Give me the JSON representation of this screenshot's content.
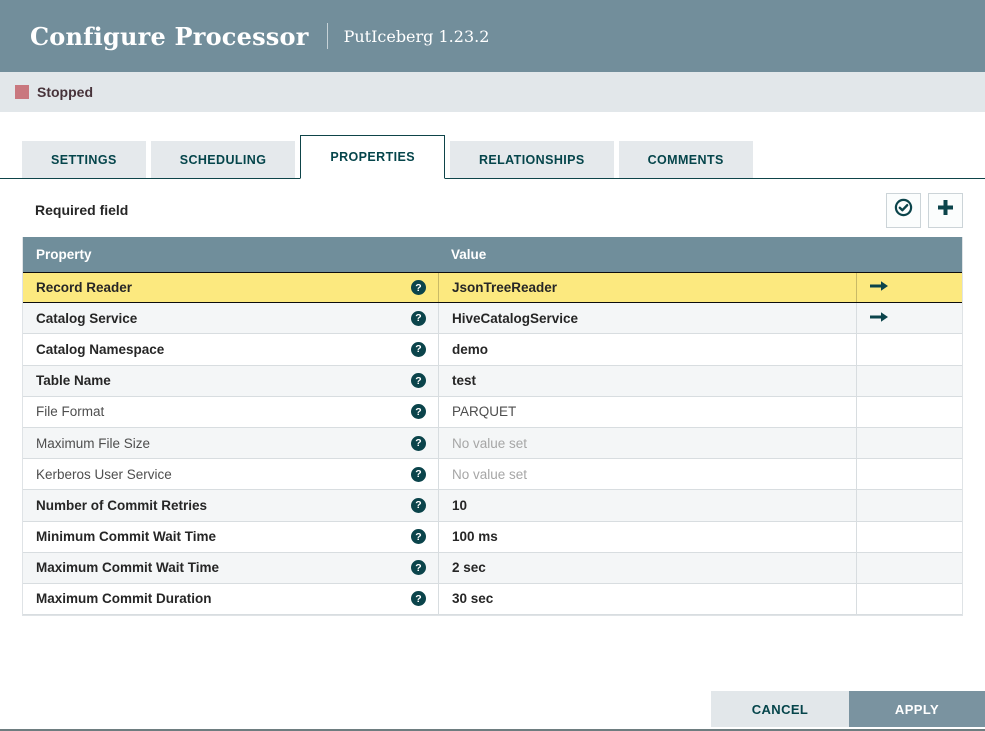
{
  "dialog": {
    "title": "Configure Processor",
    "subtitle": "PutIceberg 1.23.2",
    "status": {
      "label": "Stopped"
    },
    "tabs": [
      {
        "label": "SETTINGS",
        "active": false
      },
      {
        "label": "SCHEDULING",
        "active": false
      },
      {
        "label": "PROPERTIES",
        "active": true
      },
      {
        "label": "RELATIONSHIPS",
        "active": false
      },
      {
        "label": "COMMENTS",
        "active": false
      }
    ]
  },
  "properties_tab": {
    "required_field_label": "Required field",
    "toolbar_icons": [
      "verify-properties-icon",
      "add-property-icon"
    ],
    "table": {
      "columns": [
        "Property",
        "Value"
      ],
      "rows": [
        {
          "property": "Record Reader",
          "value": "JsonTreeReader",
          "required": true,
          "selected": true,
          "empty": false,
          "has_goto": true
        },
        {
          "property": "Catalog Service",
          "value": "HiveCatalogService",
          "required": true,
          "selected": false,
          "empty": false,
          "has_goto": true
        },
        {
          "property": "Catalog Namespace",
          "value": "demo",
          "required": true,
          "selected": false,
          "empty": false,
          "has_goto": false
        },
        {
          "property": "Table Name",
          "value": "test",
          "required": true,
          "selected": false,
          "empty": false,
          "has_goto": false
        },
        {
          "property": "File Format",
          "value": "PARQUET",
          "required": false,
          "selected": false,
          "empty": false,
          "has_goto": false
        },
        {
          "property": "Maximum File Size",
          "value": "No value set",
          "required": false,
          "selected": false,
          "empty": true,
          "has_goto": false
        },
        {
          "property": "Kerberos User Service",
          "value": "No value set",
          "required": false,
          "selected": false,
          "empty": true,
          "has_goto": false
        },
        {
          "property": "Number of Commit Retries",
          "value": "10",
          "required": true,
          "selected": false,
          "empty": false,
          "has_goto": false
        },
        {
          "property": "Minimum Commit Wait Time",
          "value": "100 ms",
          "required": true,
          "selected": false,
          "empty": false,
          "has_goto": false
        },
        {
          "property": "Maximum Commit Wait Time",
          "value": "2 sec",
          "required": true,
          "selected": false,
          "empty": false,
          "has_goto": false
        },
        {
          "property": "Maximum Commit Duration",
          "value": "30 sec",
          "required": true,
          "selected": false,
          "empty": false,
          "has_goto": false
        }
      ]
    }
  },
  "footer": {
    "cancel_label": "CANCEL",
    "apply_label": "APPLY"
  },
  "colors": {
    "header_bg": "#728e9b",
    "accent_teal": "#0b444b",
    "stopped_red": "#c9787f",
    "selected_row_yellow": "#fce97f",
    "row_stripe": "#f4f6f7",
    "status_bar_bg": "#e2e7ea",
    "apply_bg": "#7a93a0"
  }
}
